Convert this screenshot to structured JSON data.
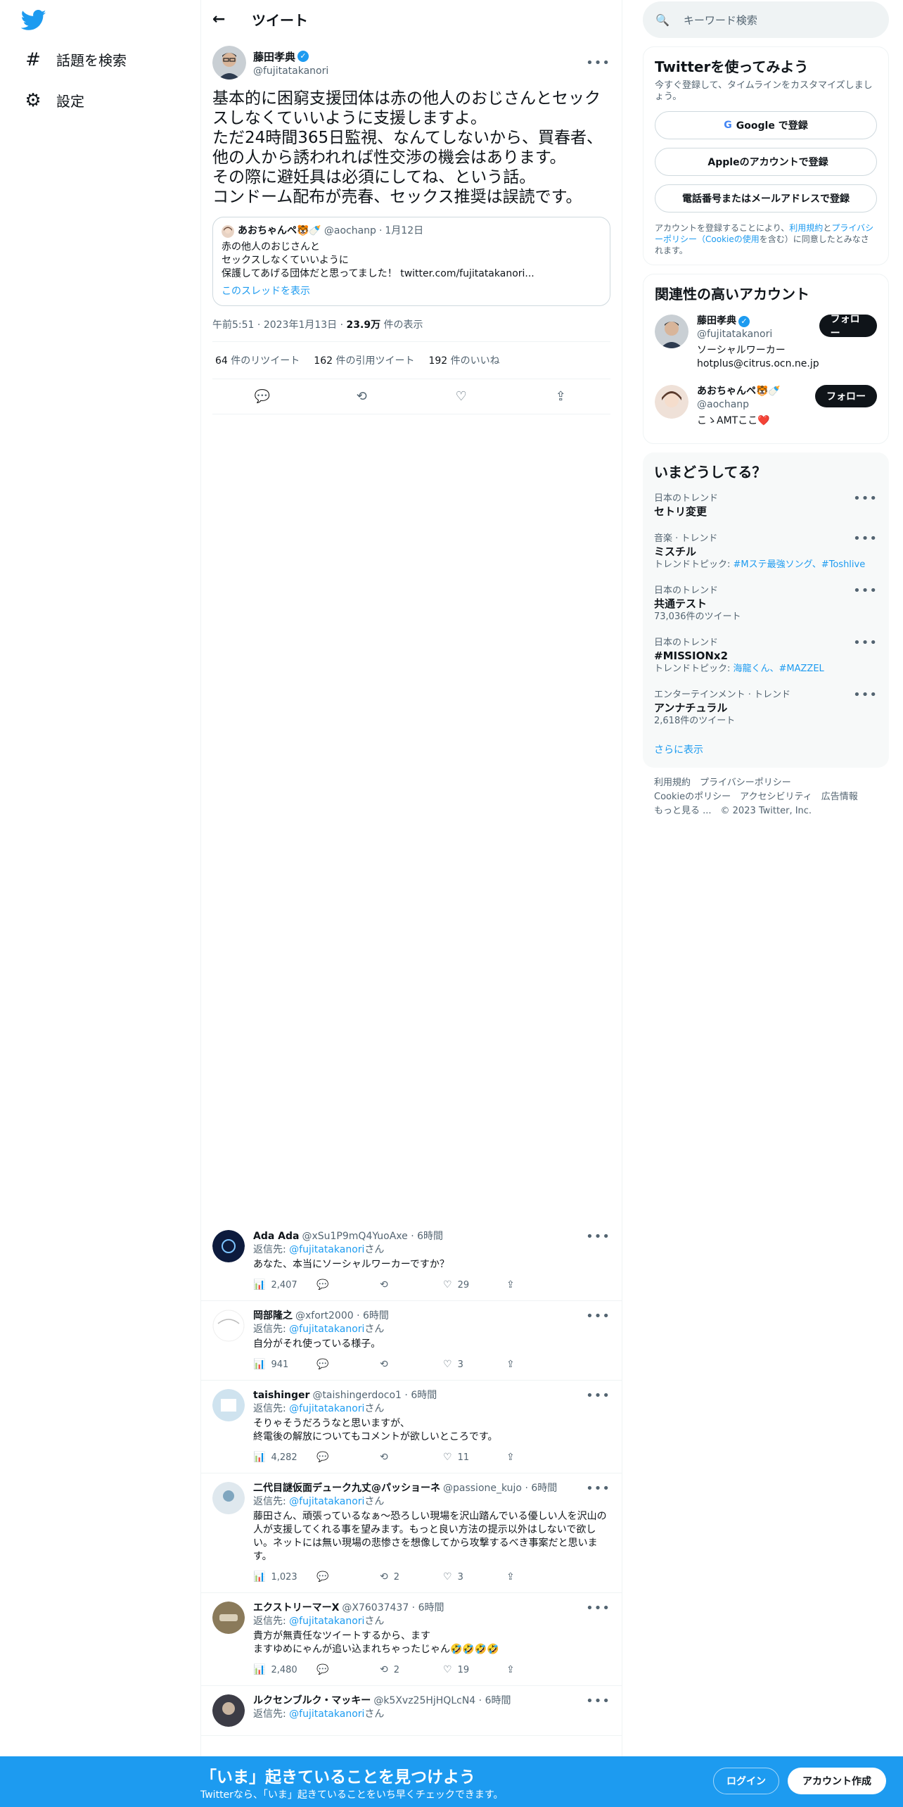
{
  "nav": {
    "explore": "話題を検索",
    "settings": "設定"
  },
  "header": {
    "title": "ツイート"
  },
  "tweet": {
    "name": "藤田孝典",
    "handle": "@fujitatakanori",
    "body": "基本的に困窮支援団体は赤の他人のおじさんとセックスしなくていいように支援しますよ。\nただ24時間365日監視、なんてしないから、買春者、他の人から誘われれば性交渉の機会はあります。\nその際に避妊具は必須にしてね、という話。\nコンドーム配布が売春、セックス推奨は誤読です。",
    "quote": {
      "name": "あおちゃんペ🐯🍼",
      "handle": "@aochanp",
      "date": "1月12日",
      "text": "赤の他人のおじさんと\nセックスしなくていいように\n保護してあげる団体だと思ってました！ twitter.com/fujitatakanori...",
      "thread_link": "このスレッドを表示"
    },
    "time": "午前5:51",
    "date": "2023年1月13日",
    "views": "23.9万",
    "views_label": "件の表示",
    "retweets": "64",
    "retweets_label": "件のリツイート",
    "quotes": "162",
    "quotes_label": "件の引用ツイート",
    "likes": "192",
    "likes_label": "件のいいね"
  },
  "replies": [
    {
      "name": "Ada Ada",
      "handle": "@xSu1P9mQ4YuoAxe",
      "time": "6時間",
      "reply_prefix": "返信先: ",
      "reply_to": "@fujitatakanori",
      "reply_suffix": "さん",
      "text": "あなた、本当にソーシャルワーカーですか？",
      "views": "2,407",
      "comments": "",
      "retweets": "",
      "likes": "29"
    },
    {
      "name": "岡部隆之",
      "handle": "@xfort2000",
      "time": "6時間",
      "reply_prefix": "返信先: ",
      "reply_to": "@fujitatakanori",
      "reply_suffix": "さん",
      "text": "自分がそれ使っている様子。",
      "views": "941",
      "comments": "",
      "retweets": "",
      "likes": "3"
    },
    {
      "name": "taishinger",
      "handle": "@taishingerdoco1",
      "time": "6時間",
      "reply_prefix": "返信先: ",
      "reply_to": "@fujitatakanori",
      "reply_suffix": "さん",
      "text": "そりゃそうだろうなと思いますが、\n終電後の解放についてもコメントが欲しいところです。",
      "views": "4,282",
      "comments": "",
      "retweets": "",
      "likes": "11"
    },
    {
      "name": "二代目謎仮面デューク九丈@パッショーネ",
      "handle": "@passione_kujo",
      "time": "6時間",
      "reply_prefix": "返信先: ",
      "reply_to": "@fujitatakanori",
      "reply_suffix": "さん",
      "text": "藤田さん、頑張っているなぁ～恐ろしい現場を沢山踏んでいる優しい人を沢山の人が支援してくれる事を望みます。もっと良い方法の提示以外はしないで欲しい。ネットには無い現場の悲惨さを想像してから攻撃するべき事案だと思います。",
      "views": "1,023",
      "comments": "",
      "retweets": "2",
      "likes": "3"
    },
    {
      "name": "エクストリーマーX",
      "handle": "@X76037437",
      "time": "6時間",
      "reply_prefix": "返信先: ",
      "reply_to": "@fujitatakanori",
      "reply_suffix": "さん",
      "text": "貴方が無責任なツイートするから、ます\nますゆめにゃんが追い込まれちゃったじゃん🤣🤣🤣🤣",
      "views": "2,480",
      "comments": "",
      "retweets": "2",
      "likes": "19"
    },
    {
      "name": "ルクセンブルク・マッキー",
      "handle": "@k5Xvz25HjHQLcN4",
      "time": "6時間",
      "reply_prefix": "返信先: ",
      "reply_to": "@fujitatakanori",
      "reply_suffix": "さん",
      "text": "",
      "views": "",
      "comments": "",
      "retweets": "",
      "likes": ""
    }
  ],
  "search": {
    "placeholder": "キーワード検索"
  },
  "signup": {
    "title": "Twitterを使ってみよう",
    "subtitle": "今すぐ登録して、タイムラインをカスタマイズしましょう。",
    "google": "Google で登録",
    "apple": "Appleのアカウントで登録",
    "phone": "電話番号またはメールアドレスで登録",
    "legal_1": "アカウントを登録することにより、",
    "legal_terms": "利用規約",
    "legal_2": "と",
    "legal_privacy": "プライバシーポリシー（Cookieの使用",
    "legal_3": "を含む）に同意したとみなされます。"
  },
  "related": {
    "title": "関連性の高いアカウント",
    "accounts": [
      {
        "name": "藤田孝典",
        "handle": "@fujitatakanori",
        "bio": "ソーシャルワーカー\nhotplus@citrus.ocn.ne.jp",
        "follow": "フォロー"
      },
      {
        "name": "あおちゃんペ🐯🍼",
        "handle": "@aochanp",
        "bio": "こゝAMTここ❤️",
        "follow": "フォロー"
      }
    ]
  },
  "trends": {
    "title": "いまどうしてる？",
    "items": [
      {
        "category": "日本のトレンド",
        "name": "セトリ変更",
        "extra": ""
      },
      {
        "category": "音楽 · トレンド",
        "name": "ミスチル",
        "extra_label": "トレンドトピック: ",
        "extra_link": "#Mステ最強ソング、#Toshlive"
      },
      {
        "category": "日本のトレンド",
        "name": "共通テスト",
        "extra": "73,036件のツイート"
      },
      {
        "category": "日本のトレンド",
        "name": "#MISSIONx2",
        "extra_label": "トレンドトピック: ",
        "extra_link": "海龍くん、#MAZZEL"
      },
      {
        "category": "エンターテインメント · トレンド",
        "name": "アンナチュラル",
        "extra": "2,618件のツイート"
      }
    ],
    "show_more": "さらに表示"
  },
  "footer": {
    "line1": "利用規約　プライバシーポリシー",
    "line2": "Cookieのポリシー　アクセシビリティ　広告情報",
    "line3": "もっと見る ...　© 2023 Twitter, Inc."
  },
  "bottom_bar": {
    "title": "「いま」起きていることを見つけよう",
    "subtitle": "Twitterなら、「いま」起きていることをいち早くチェックできます。",
    "login": "ログイン",
    "signup": "アカウント作成"
  },
  "colors": {
    "accent": "#1d9bf0",
    "text": "#0f1419",
    "secondary": "#536471"
  }
}
